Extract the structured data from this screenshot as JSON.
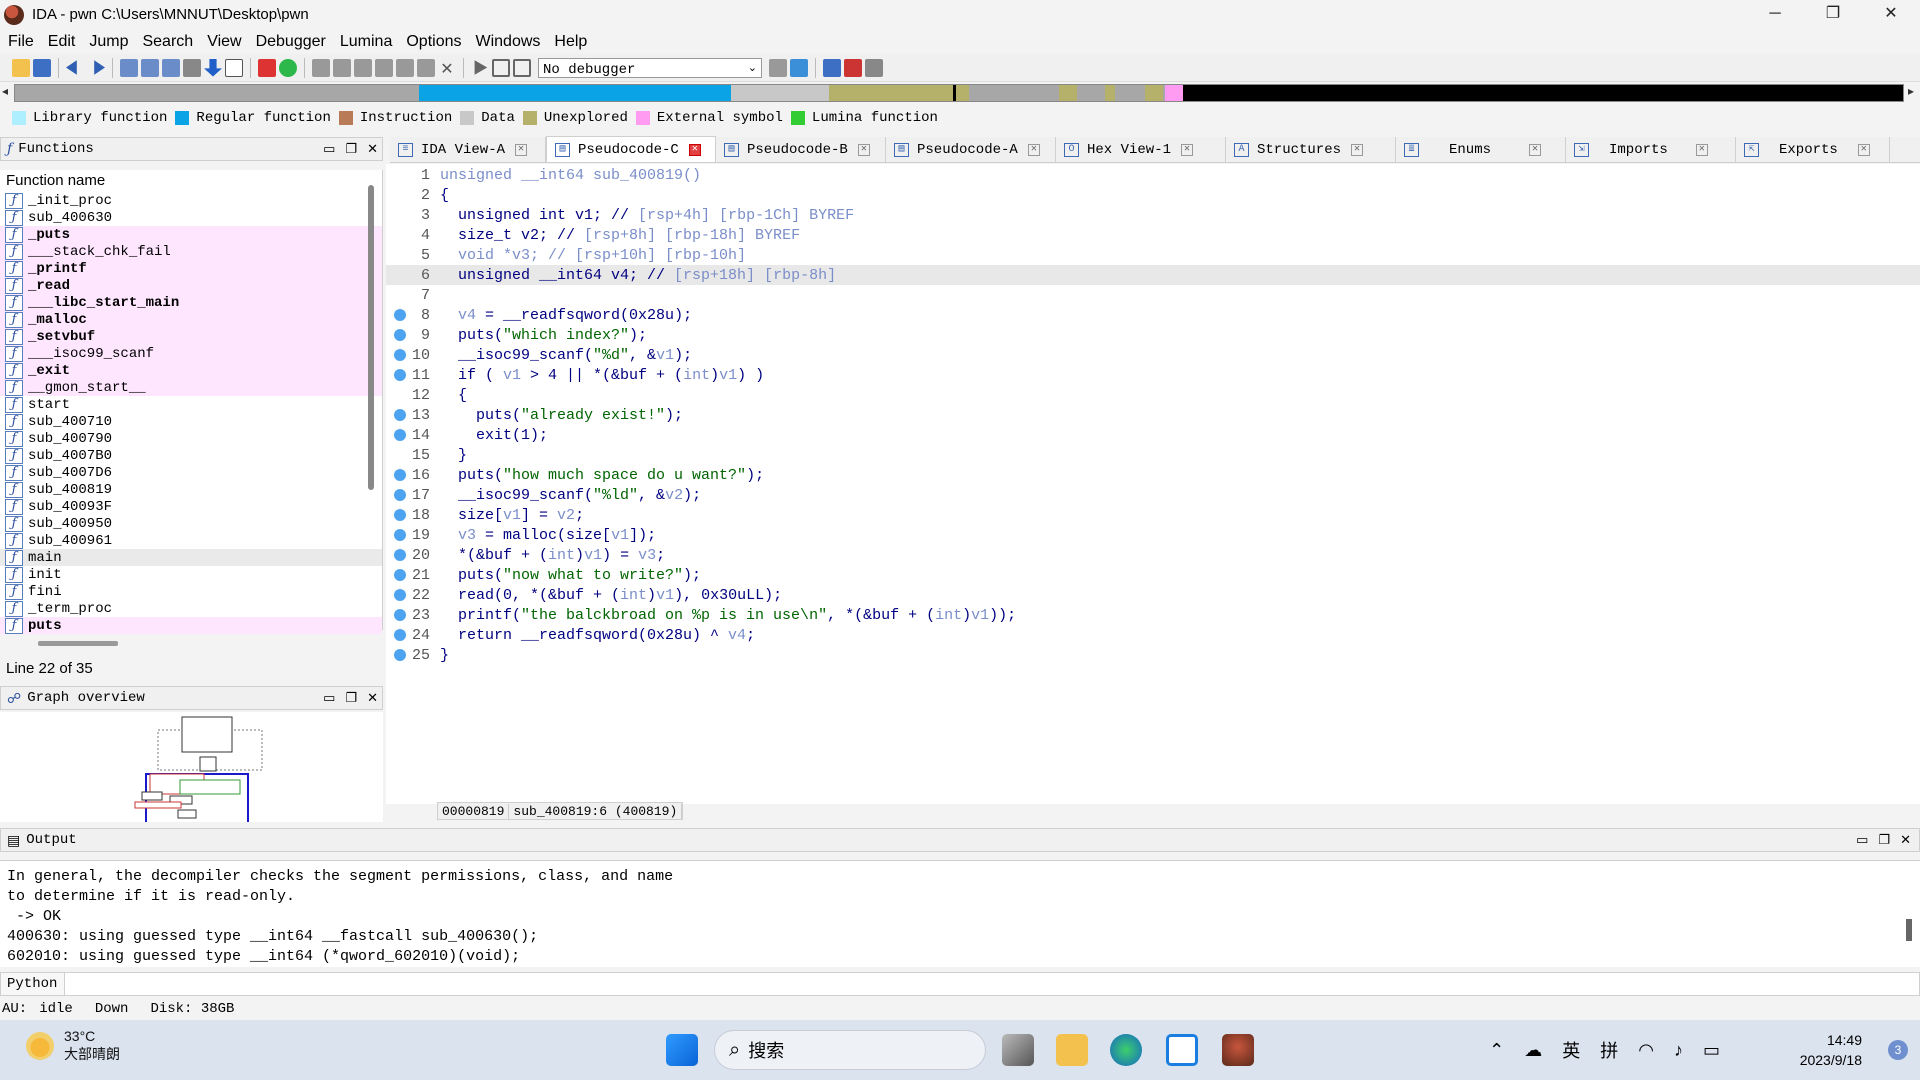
{
  "window": {
    "title": "IDA - pwn C:\\Users\\MNNUT\\Desktop\\pwn",
    "min": "─",
    "max": "❐",
    "close": "✕"
  },
  "menu": [
    "File",
    "Edit",
    "Jump",
    "Search",
    "View",
    "Debugger",
    "Lumina",
    "Options",
    "Windows",
    "Help"
  ],
  "toolbar": {
    "debugger_select": "No debugger"
  },
  "legend": [
    {
      "label": "Library function",
      "color": "#aeefff"
    },
    {
      "label": "Regular function",
      "color": "#0aa3e6"
    },
    {
      "label": "Instruction",
      "color": "#b97a57"
    },
    {
      "label": "Data",
      "color": "#c8c8c8"
    },
    {
      "label": "Unexplored",
      "color": "#b5b06a"
    },
    {
      "label": "External symbol",
      "color": "#ff9cf2"
    },
    {
      "label": "Lumina function",
      "color": "#33cc33"
    }
  ],
  "functions_panel": {
    "title": "Functions",
    "column_header": "Function name",
    "items": [
      {
        "name": "_init_proc",
        "style": ""
      },
      {
        "name": "sub_400630",
        "style": ""
      },
      {
        "name": "_puts",
        "style": "pink bold"
      },
      {
        "name": "___stack_chk_fail",
        "style": "pink"
      },
      {
        "name": "_printf",
        "style": "pink bold"
      },
      {
        "name": "_read",
        "style": "pink bold"
      },
      {
        "name": "___libc_start_main",
        "style": "pink bold"
      },
      {
        "name": "_malloc",
        "style": "pink bold"
      },
      {
        "name": "_setvbuf",
        "style": "pink bold"
      },
      {
        "name": "___isoc99_scanf",
        "style": "pink"
      },
      {
        "name": "_exit",
        "style": "pink bold"
      },
      {
        "name": "__gmon_start__",
        "style": "pink"
      },
      {
        "name": "start",
        "style": ""
      },
      {
        "name": "sub_400710",
        "style": ""
      },
      {
        "name": "sub_400790",
        "style": ""
      },
      {
        "name": "sub_4007B0",
        "style": ""
      },
      {
        "name": "sub_4007D6",
        "style": ""
      },
      {
        "name": "sub_400819",
        "style": ""
      },
      {
        "name": "sub_40093F",
        "style": ""
      },
      {
        "name": "sub_400950",
        "style": ""
      },
      {
        "name": "sub_400961",
        "style": ""
      },
      {
        "name": "main",
        "style": "sel"
      },
      {
        "name": "init",
        "style": ""
      },
      {
        "name": "fini",
        "style": ""
      },
      {
        "name": "_term_proc",
        "style": ""
      },
      {
        "name": "puts",
        "style": "pink bold"
      }
    ],
    "line_info": "Line 22 of 35"
  },
  "graph_panel": {
    "title": "Graph overview"
  },
  "tabs": [
    {
      "label": "IDA View-A",
      "active": false
    },
    {
      "label": "Pseudocode-C",
      "active": true
    },
    {
      "label": "Pseudocode-B",
      "active": false
    },
    {
      "label": "Pseudocode-A",
      "active": false
    },
    {
      "label": "Hex View-1",
      "active": false
    },
    {
      "label": "Structures",
      "active": false
    },
    {
      "label": "Enums",
      "active": false
    },
    {
      "label": "Imports",
      "active": false
    },
    {
      "label": "Exports",
      "active": false
    }
  ],
  "code": [
    {
      "n": "1",
      "dot": false,
      "html": "<span class=\"cmt\">unsigned __int64 sub_400819()</span>"
    },
    {
      "n": "2",
      "dot": false,
      "html": "{"
    },
    {
      "n": "3",
      "dot": false,
      "html": "  unsigned int v1; // <span class=\"cmt\">[rsp+4h] [rbp-1Ch] BYREF</span>"
    },
    {
      "n": "4",
      "dot": false,
      "html": "  size_t v2; // <span class=\"cmt\">[rsp+8h] [rbp-18h] BYREF</span>"
    },
    {
      "n": "5",
      "dot": false,
      "html": "  <span class=\"cmt\">void *v3; // [rsp+10h] [rbp-10h]</span>"
    },
    {
      "n": "6",
      "dot": false,
      "hl": true,
      "html": "  unsigned __int64 v4; // <span class=\"cmt\">[rsp+18h] [rbp-8h]</span>"
    },
    {
      "n": "7",
      "dot": false,
      "html": ""
    },
    {
      "n": "8",
      "dot": true,
      "html": "  <span class=\"var\">v4</span> = __readfsqword(0x28u);"
    },
    {
      "n": "9",
      "dot": true,
      "html": "  puts(<span class=\"str\">\"which index?\"</span>);"
    },
    {
      "n": "10",
      "dot": true,
      "html": "  __isoc99_scanf(<span class=\"str\">\"%d\"</span>, &amp;<span class=\"var\">v1</span>);"
    },
    {
      "n": "11",
      "dot": true,
      "html": "  if ( <span class=\"var\">v1</span> &gt; 4 || *(&amp;buf + (<span class=\"var\">int</span>)<span class=\"var\">v1</span>) )"
    },
    {
      "n": "12",
      "dot": false,
      "html": "  {"
    },
    {
      "n": "13",
      "dot": true,
      "html": "    puts(<span class=\"str\">\"already exist!\"</span>);"
    },
    {
      "n": "14",
      "dot": true,
      "html": "    exit(1);"
    },
    {
      "n": "15",
      "dot": false,
      "html": "  }"
    },
    {
      "n": "16",
      "dot": true,
      "html": "  puts(<span class=\"str\">\"how much space do u want?\"</span>);"
    },
    {
      "n": "17",
      "dot": true,
      "html": "  __isoc99_scanf(<span class=\"str\">\"%ld\"</span>, &amp;<span class=\"var\">v2</span>);"
    },
    {
      "n": "18",
      "dot": true,
      "html": "  size[<span class=\"var\">v1</span>] = <span class=\"var\">v2</span>;"
    },
    {
      "n": "19",
      "dot": true,
      "html": "  <span class=\"var\">v3</span> = malloc(size[<span class=\"var\">v1</span>]);"
    },
    {
      "n": "20",
      "dot": true,
      "html": "  *(&amp;buf + (<span class=\"var\">int</span>)<span class=\"var\">v1</span>) = <span class=\"var\">v3</span>;"
    },
    {
      "n": "21",
      "dot": true,
      "html": "  puts(<span class=\"str\">\"now what to write?\"</span>);"
    },
    {
      "n": "22",
      "dot": true,
      "html": "  read(0, *(&amp;buf + (<span class=\"var\">int</span>)<span class=\"var\">v1</span>), 0x30uLL);"
    },
    {
      "n": "23",
      "dot": true,
      "html": "  printf(<span class=\"str\">\"the balckbroad on %p is in use\\n\"</span>, *(&amp;buf + (<span class=\"var\">int</span>)<span class=\"var\">v1</span>));"
    },
    {
      "n": "24",
      "dot": true,
      "html": "  return __readfsqword(0x28u) ^ <span class=\"var\">v4</span>;"
    },
    {
      "n": "25",
      "dot": true,
      "html": "}"
    }
  ],
  "code_status": {
    "addr": "00000819",
    "loc": "sub_400819:6 (400819)"
  },
  "output": {
    "title": "Output",
    "lines": [
      "In general, the decompiler checks the segment permissions, class, and name",
      "to determine if it is read-only.",
      " -> OK",
      "400630: using guessed type __int64 __fastcall sub_400630();",
      "602010: using guessed type __int64 (*qword_602010)(void);"
    ]
  },
  "python_label": "Python",
  "statusbar": {
    "au": "AU:",
    "state": "idle",
    "dir": "Down",
    "disk": "Disk: 38GB"
  },
  "taskbar": {
    "temp": "33°C",
    "weather": "大部晴朗",
    "search_placeholder": "搜索",
    "ime1": "英",
    "ime2": "拼",
    "time": "14:49",
    "date": "2023/9/18",
    "notif": "3"
  }
}
